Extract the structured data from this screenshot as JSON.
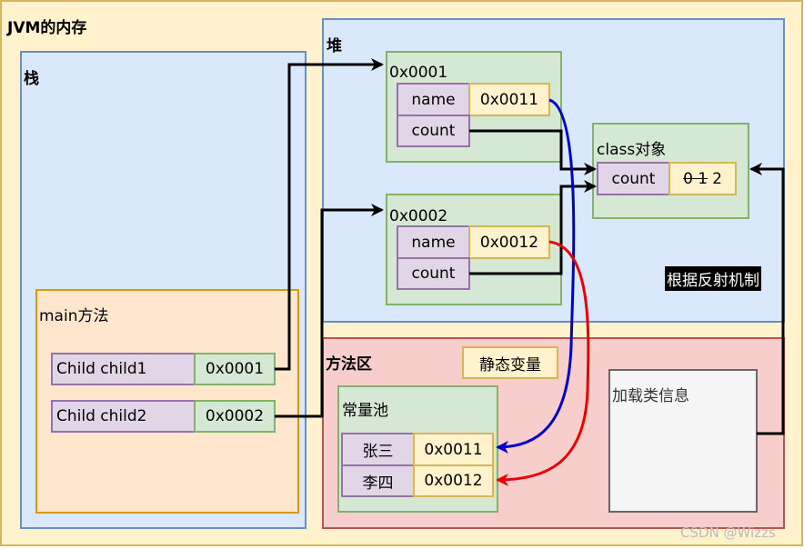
{
  "jvm": {
    "title": "JVM的内存"
  },
  "stack": {
    "title": "栈",
    "main": {
      "title": "main方法",
      "vars": [
        {
          "name": "Child child1",
          "value": "0x0001"
        },
        {
          "name": "Child child2",
          "value": "0x0002"
        }
      ]
    }
  },
  "heap": {
    "title": "堆",
    "objects": [
      {
        "address": "0x0001",
        "fields": [
          {
            "name": "name",
            "value": "0x0011"
          },
          {
            "name": "count",
            "value": ""
          }
        ]
      },
      {
        "address": "0x0002",
        "fields": [
          {
            "name": "name",
            "value": "0x0012"
          },
          {
            "name": "count",
            "value": ""
          }
        ]
      }
    ],
    "class_object": {
      "title": "class对象",
      "field": "count",
      "old_values": "0 1",
      "value": "2"
    },
    "reflection_label": "根据反射机制"
  },
  "method_area": {
    "title": "方法区",
    "static_vars": "静态变量",
    "constant_pool": {
      "title": "常量池",
      "entries": [
        {
          "key": "张三",
          "value": "0x0011"
        },
        {
          "key": "李四",
          "value": "0x0012"
        }
      ]
    },
    "class_info": "加载类信息"
  },
  "watermark": "CSDN @Wizzs",
  "colors": {
    "blue_arrow": "#0000cc",
    "red_arrow": "#ee0000"
  }
}
